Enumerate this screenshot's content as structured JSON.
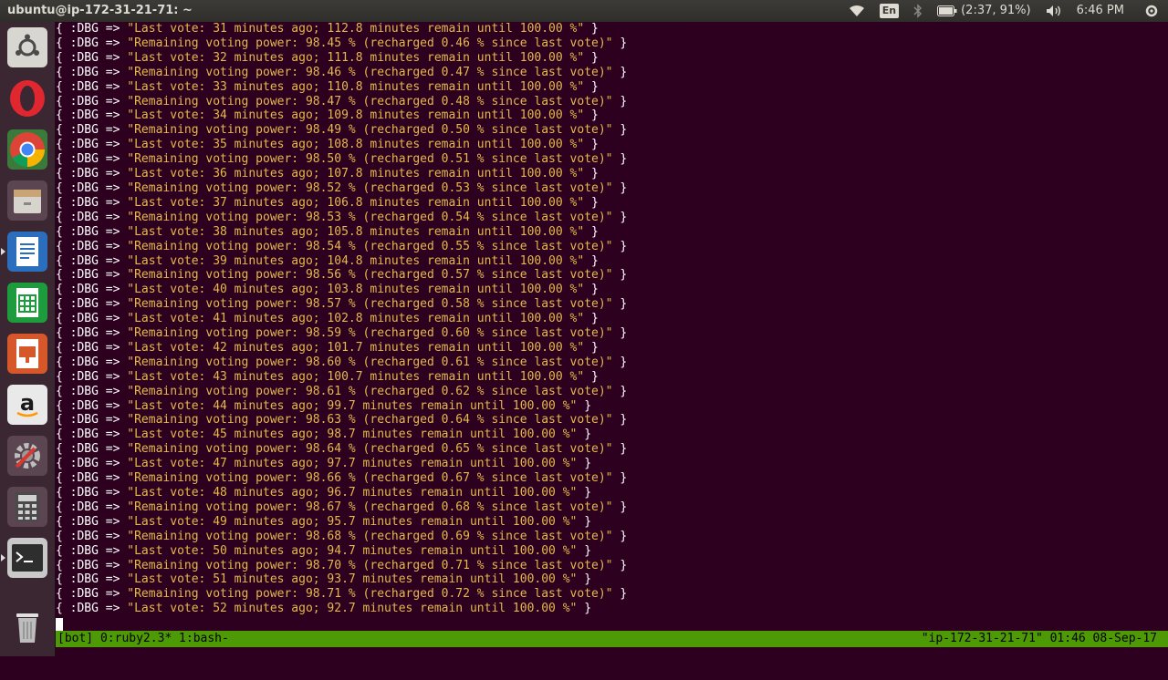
{
  "top_panel": {
    "title": "ubuntu@ip-172-31-21-71: ~",
    "keyboard_layout": "En",
    "battery_text": "(2:37, 91%)",
    "clock": "6:46 PM"
  },
  "launcher": {
    "items": [
      {
        "name": "ubuntu-dash-icon",
        "color": "#e7e5e0"
      },
      {
        "name": "opera-browser-icon",
        "color": "#e0262f"
      },
      {
        "name": "chrome-browser-icon",
        "color": "#4285f4"
      },
      {
        "name": "files-icon",
        "color": "#c9a575"
      },
      {
        "name": "libreoffice-writer-icon",
        "color": "#2a6ebd"
      },
      {
        "name": "libreoffice-calc-icon",
        "color": "#1e9b3c"
      },
      {
        "name": "libreoffice-impress-icon",
        "color": "#d6572a"
      },
      {
        "name": "amazon-icon",
        "color": "#1a1a1a"
      },
      {
        "name": "system-settings-icon",
        "color": "#9a9a9a"
      },
      {
        "name": "calculator-icon",
        "color": "#4a4a4a"
      },
      {
        "name": "terminal-icon",
        "color": "#2e2e2e"
      },
      {
        "name": "trash-icon",
        "color": "#bdbdbd"
      }
    ]
  },
  "terminal": {
    "lines": [
      {
        "prefix": "{ :DBG => ",
        "str": "\"Last vote: 31 minutes ago; 112.8 minutes remain until 100.00 %\"",
        "suffix": " }"
      },
      {
        "prefix": "{ :DBG => ",
        "str": "\"Remaining voting power: 98.45 % (recharged 0.46 % since last vote)\"",
        "suffix": " }"
      },
      {
        "prefix": "{ :DBG => ",
        "str": "\"Last vote: 32 minutes ago; 111.8 minutes remain until 100.00 %\"",
        "suffix": " }"
      },
      {
        "prefix": "{ :DBG => ",
        "str": "\"Remaining voting power: 98.46 % (recharged 0.47 % since last vote)\"",
        "suffix": " }"
      },
      {
        "prefix": "{ :DBG => ",
        "str": "\"Last vote: 33 minutes ago; 110.8 minutes remain until 100.00 %\"",
        "suffix": " }"
      },
      {
        "prefix": "{ :DBG => ",
        "str": "\"Remaining voting power: 98.47 % (recharged 0.48 % since last vote)\"",
        "suffix": " }"
      },
      {
        "prefix": "{ :DBG => ",
        "str": "\"Last vote: 34 minutes ago; 109.8 minutes remain until 100.00 %\"",
        "suffix": " }"
      },
      {
        "prefix": "{ :DBG => ",
        "str": "\"Remaining voting power: 98.49 % (recharged 0.50 % since last vote)\"",
        "suffix": " }"
      },
      {
        "prefix": "{ :DBG => ",
        "str": "\"Last vote: 35 minutes ago; 108.8 minutes remain until 100.00 %\"",
        "suffix": " }"
      },
      {
        "prefix": "{ :DBG => ",
        "str": "\"Remaining voting power: 98.50 % (recharged 0.51 % since last vote)\"",
        "suffix": " }"
      },
      {
        "prefix": "{ :DBG => ",
        "str": "\"Last vote: 36 minutes ago; 107.8 minutes remain until 100.00 %\"",
        "suffix": " }"
      },
      {
        "prefix": "{ :DBG => ",
        "str": "\"Remaining voting power: 98.52 % (recharged 0.53 % since last vote)\"",
        "suffix": " }"
      },
      {
        "prefix": "{ :DBG => ",
        "str": "\"Last vote: 37 minutes ago; 106.8 minutes remain until 100.00 %\"",
        "suffix": " }"
      },
      {
        "prefix": "{ :DBG => ",
        "str": "\"Remaining voting power: 98.53 % (recharged 0.54 % since last vote)\"",
        "suffix": " }"
      },
      {
        "prefix": "{ :DBG => ",
        "str": "\"Last vote: 38 minutes ago; 105.8 minutes remain until 100.00 %\"",
        "suffix": " }"
      },
      {
        "prefix": "{ :DBG => ",
        "str": "\"Remaining voting power: 98.54 % (recharged 0.55 % since last vote)\"",
        "suffix": " }"
      },
      {
        "prefix": "{ :DBG => ",
        "str": "\"Last vote: 39 minutes ago; 104.8 minutes remain until 100.00 %\"",
        "suffix": " }"
      },
      {
        "prefix": "{ :DBG => ",
        "str": "\"Remaining voting power: 98.56 % (recharged 0.57 % since last vote)\"",
        "suffix": " }"
      },
      {
        "prefix": "{ :DBG => ",
        "str": "\"Last vote: 40 minutes ago; 103.8 minutes remain until 100.00 %\"",
        "suffix": " }"
      },
      {
        "prefix": "{ :DBG => ",
        "str": "\"Remaining voting power: 98.57 % (recharged 0.58 % since last vote)\"",
        "suffix": " }"
      },
      {
        "prefix": "{ :DBG => ",
        "str": "\"Last vote: 41 minutes ago; 102.8 minutes remain until 100.00 %\"",
        "suffix": " }"
      },
      {
        "prefix": "{ :DBG => ",
        "str": "\"Remaining voting power: 98.59 % (recharged 0.60 % since last vote)\"",
        "suffix": " }"
      },
      {
        "prefix": "{ :DBG => ",
        "str": "\"Last vote: 42 minutes ago; 101.7 minutes remain until 100.00 %\"",
        "suffix": " }"
      },
      {
        "prefix": "{ :DBG => ",
        "str": "\"Remaining voting power: 98.60 % (recharged 0.61 % since last vote)\"",
        "suffix": " }"
      },
      {
        "prefix": "{ :DBG => ",
        "str": "\"Last vote: 43 minutes ago; 100.7 minutes remain until 100.00 %\"",
        "suffix": " }"
      },
      {
        "prefix": "{ :DBG => ",
        "str": "\"Remaining voting power: 98.61 % (recharged 0.62 % since last vote)\"",
        "suffix": " }"
      },
      {
        "prefix": "{ :DBG => ",
        "str": "\"Last vote: 44 minutes ago; 99.7 minutes remain until 100.00 %\"",
        "suffix": " }"
      },
      {
        "prefix": "{ :DBG => ",
        "str": "\"Remaining voting power: 98.63 % (recharged 0.64 % since last vote)\"",
        "suffix": " }"
      },
      {
        "prefix": "{ :DBG => ",
        "str": "\"Last vote: 45 minutes ago; 98.7 minutes remain until 100.00 %\"",
        "suffix": " }"
      },
      {
        "prefix": "{ :DBG => ",
        "str": "\"Remaining voting power: 98.64 % (recharged 0.65 % since last vote)\"",
        "suffix": " }"
      },
      {
        "prefix": "{ :DBG => ",
        "str": "\"Last vote: 47 minutes ago; 97.7 minutes remain until 100.00 %\"",
        "suffix": " }"
      },
      {
        "prefix": "{ :DBG => ",
        "str": "\"Remaining voting power: 98.66 % (recharged 0.67 % since last vote)\"",
        "suffix": " }"
      },
      {
        "prefix": "{ :DBG => ",
        "str": "\"Last vote: 48 minutes ago; 96.7 minutes remain until 100.00 %\"",
        "suffix": " }"
      },
      {
        "prefix": "{ :DBG => ",
        "str": "\"Remaining voting power: 98.67 % (recharged 0.68 % since last vote)\"",
        "suffix": " }"
      },
      {
        "prefix": "{ :DBG => ",
        "str": "\"Last vote: 49 minutes ago; 95.7 minutes remain until 100.00 %\"",
        "suffix": " }"
      },
      {
        "prefix": "{ :DBG => ",
        "str": "\"Remaining voting power: 98.68 % (recharged 0.69 % since last vote)\"",
        "suffix": " }"
      },
      {
        "prefix": "{ :DBG => ",
        "str": "\"Last vote: 50 minutes ago; 94.7 minutes remain until 100.00 %\"",
        "suffix": " }"
      },
      {
        "prefix": "{ :DBG => ",
        "str": "\"Remaining voting power: 98.70 % (recharged 0.71 % since last vote)\"",
        "suffix": " }"
      },
      {
        "prefix": "{ :DBG => ",
        "str": "\"Last vote: 51 minutes ago; 93.7 minutes remain until 100.00 %\"",
        "suffix": " }"
      },
      {
        "prefix": "{ :DBG => ",
        "str": "\"Remaining voting power: 98.71 % (recharged 0.72 % since last vote)\"",
        "suffix": " }"
      },
      {
        "prefix": "{ :DBG => ",
        "str": "\"Last vote: 52 minutes ago; 92.7 minutes remain until 100.00 %\"",
        "suffix": " }"
      }
    ],
    "colors": {
      "background": "#2c001e",
      "text": "#ffffff",
      "string": "#e5b94b"
    }
  },
  "tmux": {
    "left": "[bot] 0:ruby2.3* 1:bash-",
    "right": "\"ip-172-31-21-71\" 01:46 08-Sep-17",
    "color": "#4e9a06"
  }
}
